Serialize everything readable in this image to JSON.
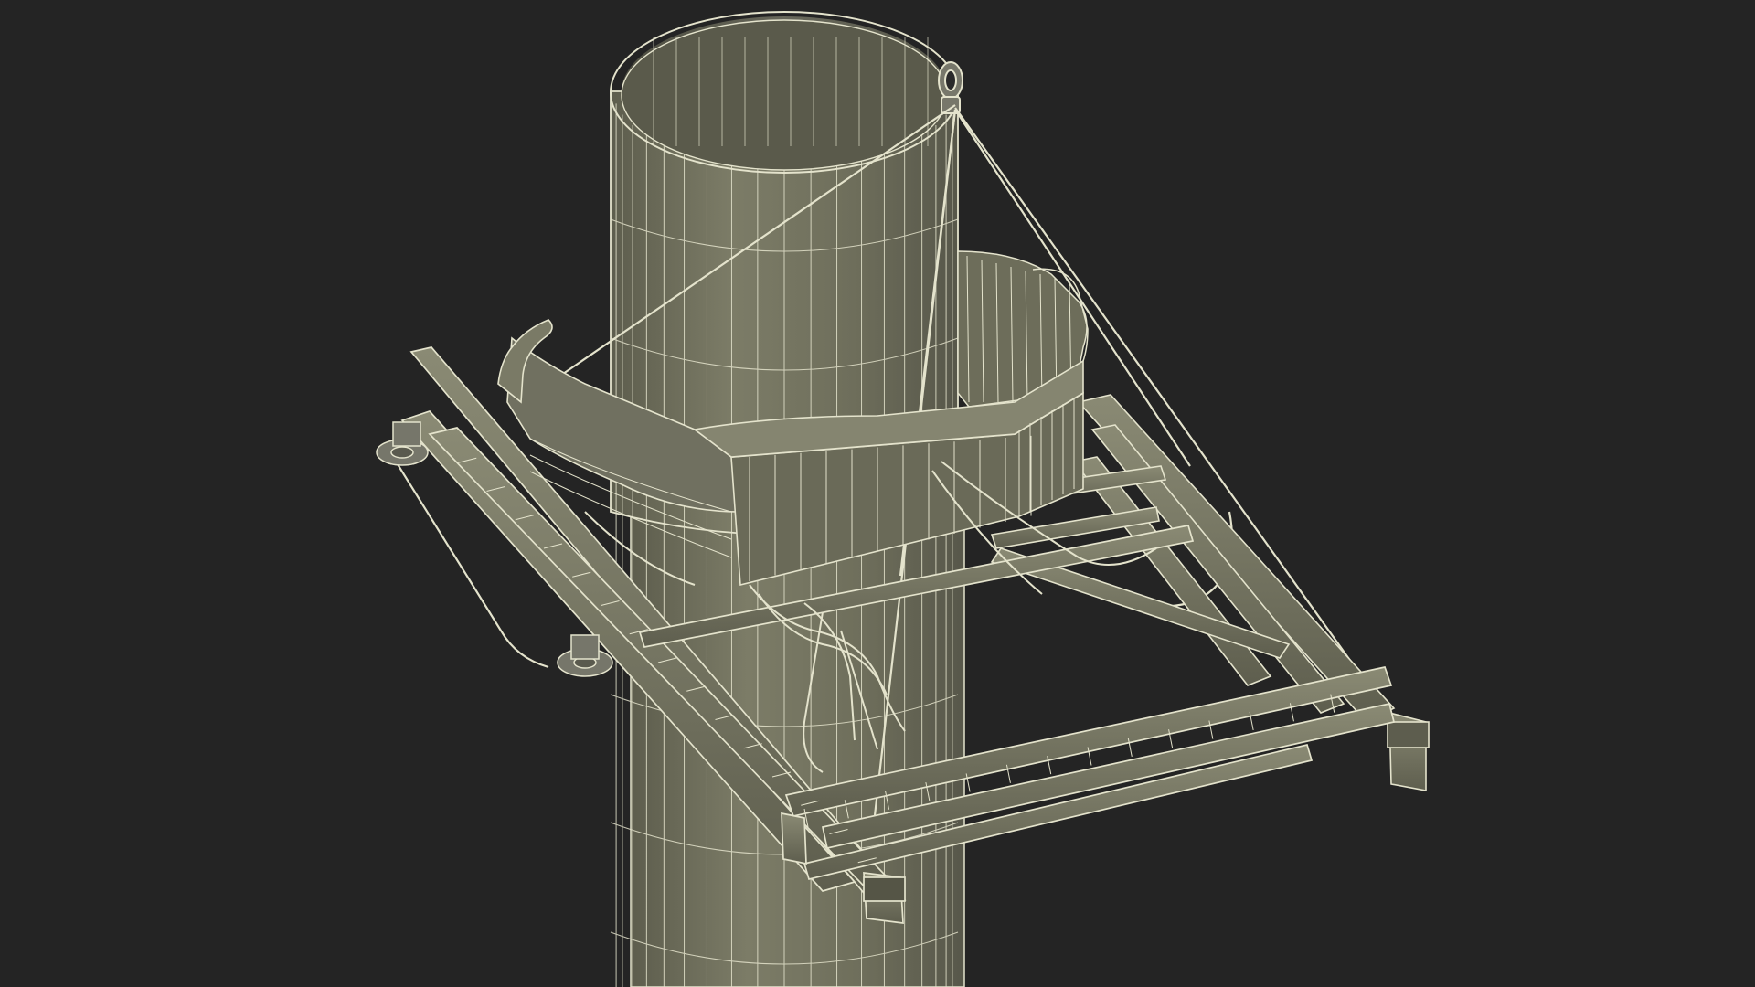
{
  "scene": {
    "subject": "wireframe-render-of-pile-gripper-frame-on-monopile",
    "colors": {
      "background": "#242424",
      "surface": "#6b6b58",
      "surface_light": "#85856f",
      "surface_dark": "#4f4f42",
      "wire": "#e4e3cc",
      "wire_dim": "#c9c8b0"
    }
  }
}
